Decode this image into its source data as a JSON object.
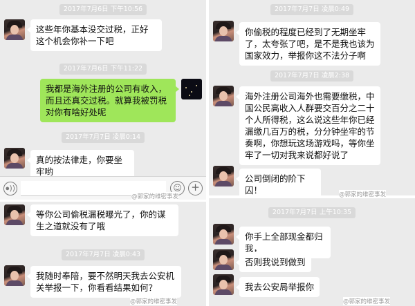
{
  "panel_top_left": {
    "time_1": "2017年7月6日 下午10:56",
    "msg_1": "这些年你基本没交过税，正好这个机会你补一下吧",
    "time_2": "2017年7月6日 下午11:22",
    "msg_2_sent": "我都是海外注册的公司有收入，而且还真交过税。就算我被罚税对你有啥好处呢",
    "time_3": "2017年7月7日 凌晨0:14",
    "msg_3": "真的按法律走，你要坐牢哟",
    "input": {
      "voice_icon": "voice-icon",
      "emoji_icon": "emoji-icon",
      "plus_icon": "plus-icon",
      "voice_glyph": "⦁))",
      "emoji_glyph": "☺",
      "plus_glyph": "+"
    }
  },
  "panel_top_right": {
    "time_1": "2017年7月7日 凌晨0:49",
    "msg_1": "你偷税的程度已经到了无期坐牢了，太夸张了吧，是不是我也该为国家效力，举报你这不法分子啊",
    "time_2": "2017年7月7日 凌晨2:38",
    "msg_2": "海外注册公司海外也需要缴税，中国公民高收入人群要交百分之二十个人所得税，这么说这些年你已经漏缴几百万的税，分分钟坐牢的节奏啊，你想玩这场游戏吗，等你坐牢了一切对我来说都好说了",
    "msg_3": "公司倒闭的阶下囚！"
  },
  "panel_bottom_left": {
    "msg_1": "等你公司偷税漏税曝光了，你的谋生之道就没有了哦",
    "time_1": "2017年7月7日 凌晨0:43",
    "msg_2": "我随时奉陪，要不然明天我去公安机关举报一下，你看看结果如何？"
  },
  "panel_bottom_right": {
    "time_1": "2017年7月7日 上午10:35",
    "msg_1": "你手上全部现金都归我，",
    "msg_2": "否则我说到做到",
    "msg_3": "我去公安局举报你"
  },
  "watermarks": {
    "wm_1": "@郭家的维密事发",
    "wm_2": "@郭家的维密事发",
    "wm_3": "@郭家的维密事发",
    "wm_4": "@郭家的维密事发"
  },
  "colors": {
    "chat_background": "#ebebeb",
    "received_bubble": "#ffffff",
    "sent_bubble": "#9fe65a",
    "timestamp_chip": "#d9d9d9"
  }
}
